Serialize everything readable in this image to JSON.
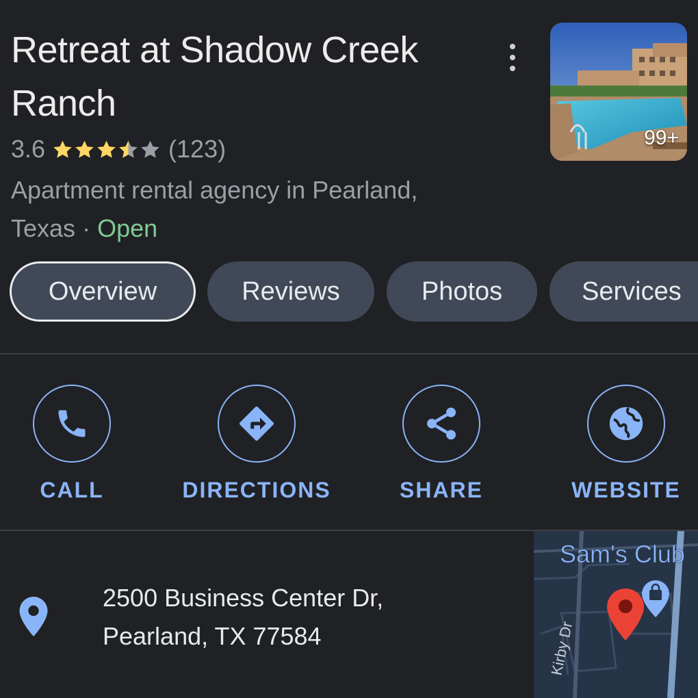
{
  "place": {
    "title": "Retreat at Shadow Creek Ranch",
    "rating": "3.6",
    "reviews_count": "(123)",
    "category": "Apartment rental agency in Pearland,",
    "location": "Texas",
    "separator": "·",
    "status": "Open",
    "stars": {
      "value": 3.6,
      "max": 5
    },
    "photo_count": "99+"
  },
  "tabs": [
    {
      "label": "Overview",
      "active": true
    },
    {
      "label": "Reviews",
      "active": false
    },
    {
      "label": "Photos",
      "active": false
    },
    {
      "label": "Services",
      "active": false
    }
  ],
  "actions": [
    {
      "label": "CALL",
      "icon": "phone-icon"
    },
    {
      "label": "DIRECTIONS",
      "icon": "directions-icon"
    },
    {
      "label": "SHARE",
      "icon": "share-icon"
    },
    {
      "label": "WEBSITE",
      "icon": "globe-icon"
    }
  ],
  "address": {
    "line1": "2500 Business Center Dr,",
    "line2": "Pearland, TX 77584"
  },
  "map": {
    "poi_label": "Sam's Club",
    "street_label": "Kirby Dr"
  },
  "colors": {
    "background": "#202124",
    "accent": "#8ab4f8",
    "open_green": "#81c995",
    "star": "#fdd663",
    "chip": "#414958"
  }
}
